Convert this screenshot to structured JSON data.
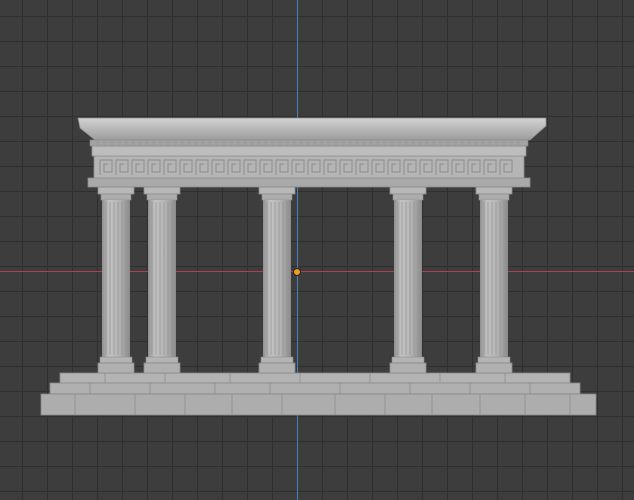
{
  "viewport": {
    "view": "front-orthographic",
    "background": "#3d3d3d",
    "grid_color": "#2f2f2f",
    "x_axis_color": "#a8434f",
    "y_axis_color": "#4a7fbf",
    "origin_color": "#f0a020"
  },
  "model": {
    "object": "classical-colonnade",
    "material_color": "#b3b3b3",
    "column_count": 5
  }
}
